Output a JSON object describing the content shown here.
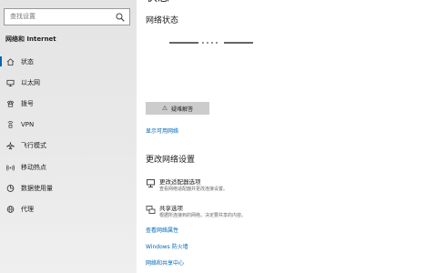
{
  "sidebar": {
    "search_placeholder": "查找设置",
    "section_title": "网络和 Internet",
    "items": [
      {
        "label": "状态",
        "icon": "home-icon",
        "active": true
      },
      {
        "label": "以太网",
        "icon": "ethernet-icon"
      },
      {
        "label": "拨号",
        "icon": "dialup-icon"
      },
      {
        "label": "VPN",
        "icon": "vpn-icon"
      },
      {
        "label": "飞行模式",
        "icon": "airplane-icon"
      },
      {
        "label": "移动热点",
        "icon": "hotspot-icon"
      },
      {
        "label": "数据使用量",
        "icon": "data-usage-icon"
      },
      {
        "label": "代理",
        "icon": "globe-icon"
      }
    ]
  },
  "main": {
    "page_title": "状态",
    "network_status_title": "网络状态",
    "troubleshoot_label": "疑难解答",
    "show_available_networks": "显示可用网络",
    "change_settings_title": "更改网络设置",
    "options": [
      {
        "title": "更改适配器选项",
        "desc": "查看网络适配器并更改连接设置。",
        "icon": "adapter-icon"
      },
      {
        "title": "共享选项",
        "desc": "根据所连接到的网络，决定要共享的内容。",
        "icon": "sharing-icon"
      }
    ],
    "links": {
      "network_properties": "查看网络属性",
      "firewall": "Windows 防火墙",
      "sharing_center": "网络和共享中心"
    }
  },
  "colors": {
    "accent": "#0063b1",
    "link": "#0067b8"
  }
}
